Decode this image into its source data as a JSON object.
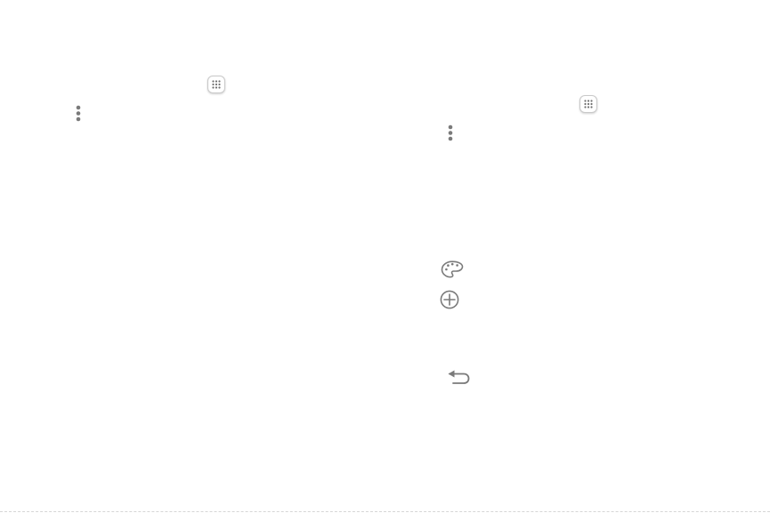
{
  "colors": {
    "icon_gray": "#7a7a7a",
    "dot_gray": "#6f6f6f",
    "icon_border": "#c9c9c9"
  },
  "left_column": {
    "icons": [
      "apps-icon",
      "more-options-icon"
    ]
  },
  "right_column": {
    "icons": [
      "apps-icon",
      "more-options-icon",
      "palette-icon",
      "add-circle-icon",
      "back-icon"
    ]
  }
}
